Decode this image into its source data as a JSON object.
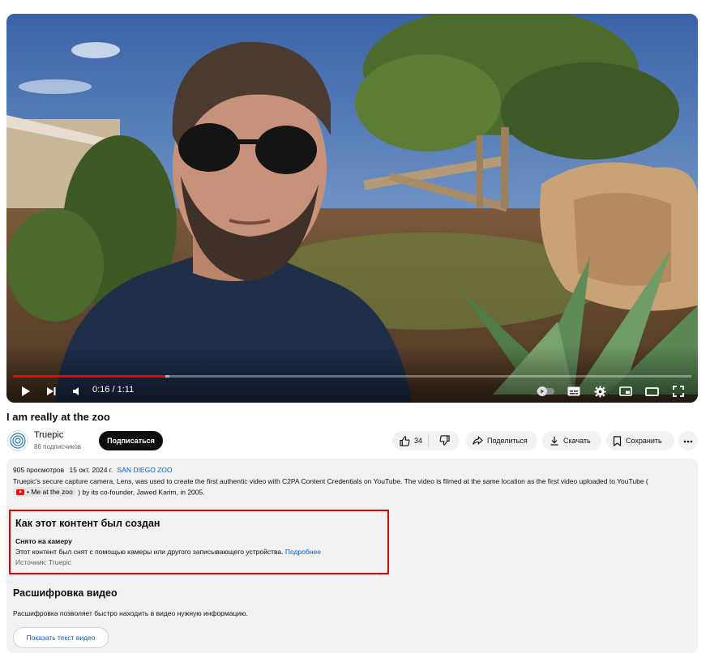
{
  "player": {
    "time_current": "0:16",
    "time_separator": " / ",
    "time_total": "1:11",
    "progress_played": 0.225,
    "progress_loaded": 0.23
  },
  "video": {
    "title": "I am really at the zoo"
  },
  "channel": {
    "name": "Truepic",
    "subscribers": "86 подписчиков",
    "subscribe_label": "Подписаться"
  },
  "actions": {
    "likes": "34",
    "share_label": "Поделиться",
    "download_label": "Скачать",
    "save_label": "Сохранить"
  },
  "description": {
    "views": "905 просмотров",
    "date": "15 окт. 2024 г.",
    "location": "SAN DIEGO ZOO",
    "text_before": "Truepic's secure capture camera, Lens, was used to create the first authentic video with C2PA Content Credentials on YouTube. The video is filmed at the same location as the first video uploaded to YouTube (",
    "linked_video": "• Me at the zoo",
    "text_after": ") by its co-founder, Jawed Karim, in 2005."
  },
  "how_created": {
    "title": "Как этот контент был создан",
    "subtitle": "Снято на камеру",
    "text": "Этот контент был снят с помощью камеры или другого записывающего устройства.",
    "more_link": "Подробнее",
    "source": "Источник: Truepic"
  },
  "transcript": {
    "title": "Расшифровка видео",
    "text": "Расшифровка позволяет быстро находить в видео нужную информацию.",
    "button_label": "Показать текст видео"
  },
  "colors": {
    "accent_red": "#ff0000",
    "link_blue": "#065fd4",
    "highlight_box": "#e00000"
  },
  "icons": [
    "play-icon",
    "next-icon",
    "volume-icon",
    "autoplay-toggle-icon",
    "subtitles-icon",
    "settings-icon",
    "miniplayer-icon",
    "theater-icon",
    "fullscreen-icon",
    "like-icon",
    "dislike-icon",
    "share-icon",
    "download-icon",
    "save-icon",
    "more-icon"
  ]
}
